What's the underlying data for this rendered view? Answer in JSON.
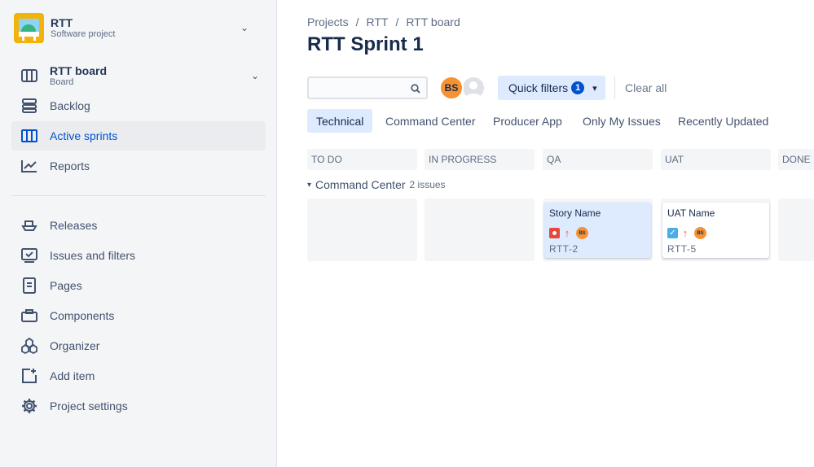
{
  "project": {
    "name": "RTT",
    "type": "Software project"
  },
  "board": {
    "name": "RTT board",
    "sub": "Board"
  },
  "nav": {
    "backlog": "Backlog",
    "active_sprints": "Active sprints",
    "reports": "Reports",
    "releases": "Releases",
    "issues_filters": "Issues and filters",
    "pages": "Pages",
    "components": "Components",
    "organizer": "Organizer",
    "add_item": "Add item",
    "project_settings": "Project settings"
  },
  "breadcrumb": [
    "Projects",
    "RTT",
    "RTT board"
  ],
  "breadcrumb_sep": "/",
  "title": "RTT Sprint 1",
  "search": {
    "placeholder": ""
  },
  "avatar_initials": "BS",
  "quick_filters": {
    "label": "Quick filters",
    "count": "1"
  },
  "clear_all": "Clear all",
  "filters": [
    "Technical",
    "Command Center",
    "Producer App",
    "Only My Issues",
    "Recently Updated"
  ],
  "columns": [
    "To Do",
    "In Progress",
    "QA",
    "UAT",
    "Done"
  ],
  "swimlane": {
    "name": "Command Center",
    "count": "2 issues"
  },
  "cards": [
    {
      "title": "Story Name",
      "key": "RTT-2",
      "type": "bug",
      "priority": "high",
      "assignee": "BS",
      "column": "QA"
    },
    {
      "title": "UAT Name",
      "key": "RTT-5",
      "type": "task",
      "priority": "high",
      "assignee": "BS",
      "column": "UAT"
    }
  ],
  "colors": {
    "accent": "#0052cc",
    "selected_bg": "#deebff",
    "sidebar_bg": "#f4f5f7",
    "avatar": "#f79232"
  }
}
